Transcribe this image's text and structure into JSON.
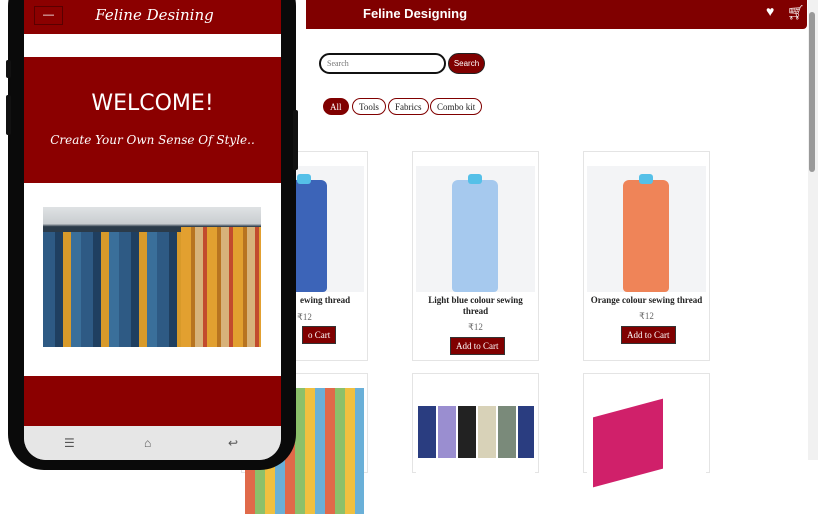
{
  "site": {
    "title": "Feline Designing",
    "icons": [
      "heart-icon",
      "cart-icon"
    ],
    "search": {
      "placeholder": "Search",
      "button": "Search"
    },
    "filters": [
      "All",
      "Tools",
      "Fabrics",
      "Combo kit"
    ],
    "active_filter": "All",
    "products": [
      {
        "name": "Blue colour sewing thread",
        "name_visible": "ewing thread",
        "price": "₹12",
        "color": "#3c64b8",
        "button": "Add to Cart",
        "button_visible": "o Cart"
      },
      {
        "name": "Light blue colour sewing thread",
        "price": "₹12",
        "color": "#a6c9ee",
        "button": "Add to Cart"
      },
      {
        "name": "Orange colour sewing thread",
        "price": "₹12",
        "color": "#ef8458",
        "button": "Add to Cart"
      }
    ],
    "accent": "#800000"
  },
  "phone": {
    "title": "Feline Desining",
    "menu_icon": "hamburger-icon",
    "welcome": "WELCOME!",
    "tagline": "Create Your Own Sense Of Style..",
    "nav": [
      "menu-icon",
      "home-icon",
      "back-icon"
    ]
  }
}
